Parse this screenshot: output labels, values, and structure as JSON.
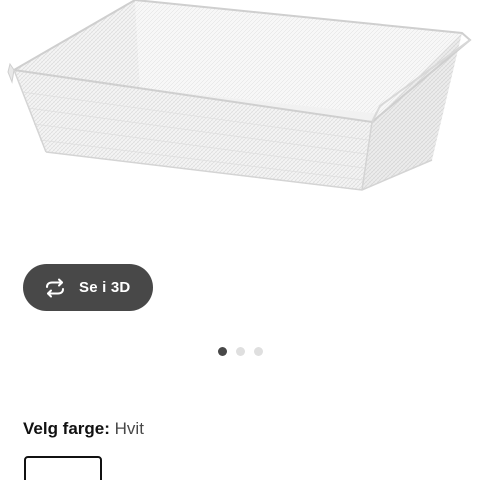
{
  "product": {
    "image_icon": "mesh-basket-white",
    "view_3d_label": "Se i 3D",
    "view_3d_icon": "rotate-3d-icon"
  },
  "carousel": {
    "dot_count": 3,
    "active_index": 0
  },
  "color_selector": {
    "title": "Velg farge:",
    "selected_value": "Hvit",
    "swatches": [
      "Hvit"
    ]
  },
  "colors": {
    "button_bg": "#484848",
    "dot_active": "#484848",
    "dot_inactive": "#dfdfdf"
  }
}
